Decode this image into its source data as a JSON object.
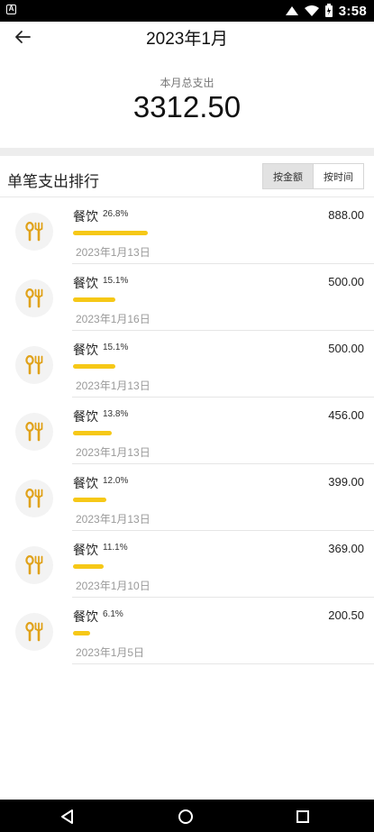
{
  "status_bar": {
    "app_icon_letter": "A",
    "time": "3:58"
  },
  "header": {
    "title": "2023年1月"
  },
  "summary": {
    "label": "本月总支出",
    "total": "3312.50"
  },
  "ranking": {
    "title": "单笔支出排行",
    "sort_by_amount": "按金额",
    "sort_by_time": "按时间",
    "active_sort": "按金额"
  },
  "colors": {
    "accent": "#f6c817",
    "icon": "#e0a21a"
  },
  "records": [
    {
      "icon": "fork-spoon-icon",
      "category": "餐饮",
      "percent": "26.8%",
      "fraction": 0.268,
      "amount": "888.00",
      "date": "2023年1月13日"
    },
    {
      "icon": "fork-spoon-icon",
      "category": "餐饮",
      "percent": "15.1%",
      "fraction": 0.151,
      "amount": "500.00",
      "date": "2023年1月16日"
    },
    {
      "icon": "fork-spoon-icon",
      "category": "餐饮",
      "percent": "15.1%",
      "fraction": 0.151,
      "amount": "500.00",
      "date": "2023年1月13日"
    },
    {
      "icon": "fork-spoon-icon",
      "category": "餐饮",
      "percent": "13.8%",
      "fraction": 0.138,
      "amount": "456.00",
      "date": "2023年1月13日"
    },
    {
      "icon": "fork-spoon-icon",
      "category": "餐饮",
      "percent": "12.0%",
      "fraction": 0.12,
      "amount": "399.00",
      "date": "2023年1月13日"
    },
    {
      "icon": "fork-spoon-icon",
      "category": "餐饮",
      "percent": "11.1%",
      "fraction": 0.111,
      "amount": "369.00",
      "date": "2023年1月10日"
    },
    {
      "icon": "fork-spoon-icon",
      "category": "餐饮",
      "percent": "6.1%",
      "fraction": 0.061,
      "amount": "200.50",
      "date": "2023年1月5日"
    }
  ]
}
